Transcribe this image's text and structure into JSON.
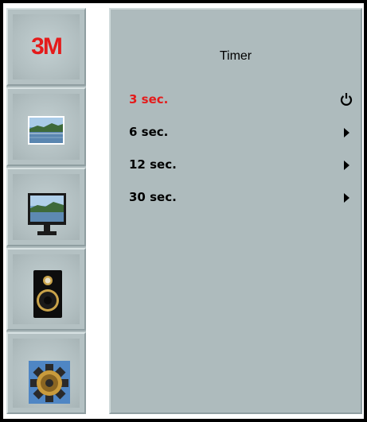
{
  "sidebar": {
    "brand": {
      "text": "3M",
      "color": "#e41b1b"
    },
    "items": [
      {
        "name": "picture",
        "icon": "landscape-picture-icon"
      },
      {
        "name": "display",
        "icon": "monitor-icon"
      },
      {
        "name": "audio",
        "icon": "speaker-icon"
      },
      {
        "name": "settings",
        "icon": "gear-icon"
      }
    ]
  },
  "panel": {
    "title": "Timer",
    "items": [
      {
        "label": "3 sec.",
        "selected": true,
        "icon": "power-icon"
      },
      {
        "label": "6 sec.",
        "selected": false,
        "icon": "arrow-right-icon"
      },
      {
        "label": "12 sec.",
        "selected": false,
        "icon": "arrow-right-icon"
      },
      {
        "label": "30 sec.",
        "selected": false,
        "icon": "arrow-right-icon"
      }
    ]
  },
  "colors": {
    "accent_selected": "#e41b1b",
    "panel_bg": "#aebbbd",
    "frame": "#000000"
  }
}
